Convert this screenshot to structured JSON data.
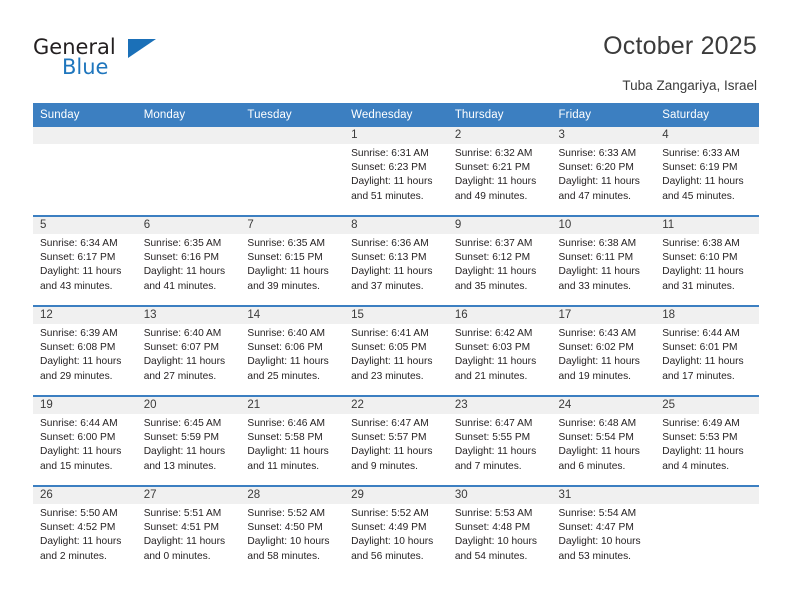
{
  "brand": {
    "name_top": "General",
    "name_bottom": "Blue",
    "accent_color": "#1b70b8",
    "triangle_icon": "triangle-icon"
  },
  "header": {
    "title": "October 2025",
    "subtitle": "Tuba Zangariya, Israel"
  },
  "calendar": {
    "header_bg": "#3c7fc1",
    "daynum_bg": "#f0f0f0",
    "weekday_headers": [
      "Sunday",
      "Monday",
      "Tuesday",
      "Wednesday",
      "Thursday",
      "Friday",
      "Saturday"
    ],
    "weeks": [
      [
        {
          "day": "",
          "lines": []
        },
        {
          "day": "",
          "lines": []
        },
        {
          "day": "",
          "lines": []
        },
        {
          "day": "1",
          "lines": [
            "Sunrise: 6:31 AM",
            "Sunset: 6:23 PM",
            "Daylight: 11 hours",
            "and 51 minutes."
          ]
        },
        {
          "day": "2",
          "lines": [
            "Sunrise: 6:32 AM",
            "Sunset: 6:21 PM",
            "Daylight: 11 hours",
            "and 49 minutes."
          ]
        },
        {
          "day": "3",
          "lines": [
            "Sunrise: 6:33 AM",
            "Sunset: 6:20 PM",
            "Daylight: 11 hours",
            "and 47 minutes."
          ]
        },
        {
          "day": "4",
          "lines": [
            "Sunrise: 6:33 AM",
            "Sunset: 6:19 PM",
            "Daylight: 11 hours",
            "and 45 minutes."
          ]
        }
      ],
      [
        {
          "day": "5",
          "lines": [
            "Sunrise: 6:34 AM",
            "Sunset: 6:17 PM",
            "Daylight: 11 hours",
            "and 43 minutes."
          ]
        },
        {
          "day": "6",
          "lines": [
            "Sunrise: 6:35 AM",
            "Sunset: 6:16 PM",
            "Daylight: 11 hours",
            "and 41 minutes."
          ]
        },
        {
          "day": "7",
          "lines": [
            "Sunrise: 6:35 AM",
            "Sunset: 6:15 PM",
            "Daylight: 11 hours",
            "and 39 minutes."
          ]
        },
        {
          "day": "8",
          "lines": [
            "Sunrise: 6:36 AM",
            "Sunset: 6:13 PM",
            "Daylight: 11 hours",
            "and 37 minutes."
          ]
        },
        {
          "day": "9",
          "lines": [
            "Sunrise: 6:37 AM",
            "Sunset: 6:12 PM",
            "Daylight: 11 hours",
            "and 35 minutes."
          ]
        },
        {
          "day": "10",
          "lines": [
            "Sunrise: 6:38 AM",
            "Sunset: 6:11 PM",
            "Daylight: 11 hours",
            "and 33 minutes."
          ]
        },
        {
          "day": "11",
          "lines": [
            "Sunrise: 6:38 AM",
            "Sunset: 6:10 PM",
            "Daylight: 11 hours",
            "and 31 minutes."
          ]
        }
      ],
      [
        {
          "day": "12",
          "lines": [
            "Sunrise: 6:39 AM",
            "Sunset: 6:08 PM",
            "Daylight: 11 hours",
            "and 29 minutes."
          ]
        },
        {
          "day": "13",
          "lines": [
            "Sunrise: 6:40 AM",
            "Sunset: 6:07 PM",
            "Daylight: 11 hours",
            "and 27 minutes."
          ]
        },
        {
          "day": "14",
          "lines": [
            "Sunrise: 6:40 AM",
            "Sunset: 6:06 PM",
            "Daylight: 11 hours",
            "and 25 minutes."
          ]
        },
        {
          "day": "15",
          "lines": [
            "Sunrise: 6:41 AM",
            "Sunset: 6:05 PM",
            "Daylight: 11 hours",
            "and 23 minutes."
          ]
        },
        {
          "day": "16",
          "lines": [
            "Sunrise: 6:42 AM",
            "Sunset: 6:03 PM",
            "Daylight: 11 hours",
            "and 21 minutes."
          ]
        },
        {
          "day": "17",
          "lines": [
            "Sunrise: 6:43 AM",
            "Sunset: 6:02 PM",
            "Daylight: 11 hours",
            "and 19 minutes."
          ]
        },
        {
          "day": "18",
          "lines": [
            "Sunrise: 6:44 AM",
            "Sunset: 6:01 PM",
            "Daylight: 11 hours",
            "and 17 minutes."
          ]
        }
      ],
      [
        {
          "day": "19",
          "lines": [
            "Sunrise: 6:44 AM",
            "Sunset: 6:00 PM",
            "Daylight: 11 hours",
            "and 15 minutes."
          ]
        },
        {
          "day": "20",
          "lines": [
            "Sunrise: 6:45 AM",
            "Sunset: 5:59 PM",
            "Daylight: 11 hours",
            "and 13 minutes."
          ]
        },
        {
          "day": "21",
          "lines": [
            "Sunrise: 6:46 AM",
            "Sunset: 5:58 PM",
            "Daylight: 11 hours",
            "and 11 minutes."
          ]
        },
        {
          "day": "22",
          "lines": [
            "Sunrise: 6:47 AM",
            "Sunset: 5:57 PM",
            "Daylight: 11 hours",
            "and 9 minutes."
          ]
        },
        {
          "day": "23",
          "lines": [
            "Sunrise: 6:47 AM",
            "Sunset: 5:55 PM",
            "Daylight: 11 hours",
            "and 7 minutes."
          ]
        },
        {
          "day": "24",
          "lines": [
            "Sunrise: 6:48 AM",
            "Sunset: 5:54 PM",
            "Daylight: 11 hours",
            "and 6 minutes."
          ]
        },
        {
          "day": "25",
          "lines": [
            "Sunrise: 6:49 AM",
            "Sunset: 5:53 PM",
            "Daylight: 11 hours",
            "and 4 minutes."
          ]
        }
      ],
      [
        {
          "day": "26",
          "lines": [
            "Sunrise: 5:50 AM",
            "Sunset: 4:52 PM",
            "Daylight: 11 hours",
            "and 2 minutes."
          ]
        },
        {
          "day": "27",
          "lines": [
            "Sunrise: 5:51 AM",
            "Sunset: 4:51 PM",
            "Daylight: 11 hours",
            "and 0 minutes."
          ]
        },
        {
          "day": "28",
          "lines": [
            "Sunrise: 5:52 AM",
            "Sunset: 4:50 PM",
            "Daylight: 10 hours",
            "and 58 minutes."
          ]
        },
        {
          "day": "29",
          "lines": [
            "Sunrise: 5:52 AM",
            "Sunset: 4:49 PM",
            "Daylight: 10 hours",
            "and 56 minutes."
          ]
        },
        {
          "day": "30",
          "lines": [
            "Sunrise: 5:53 AM",
            "Sunset: 4:48 PM",
            "Daylight: 10 hours",
            "and 54 minutes."
          ]
        },
        {
          "day": "31",
          "lines": [
            "Sunrise: 5:54 AM",
            "Sunset: 4:47 PM",
            "Daylight: 10 hours",
            "and 53 minutes."
          ]
        },
        {
          "day": "",
          "lines": []
        }
      ]
    ]
  }
}
